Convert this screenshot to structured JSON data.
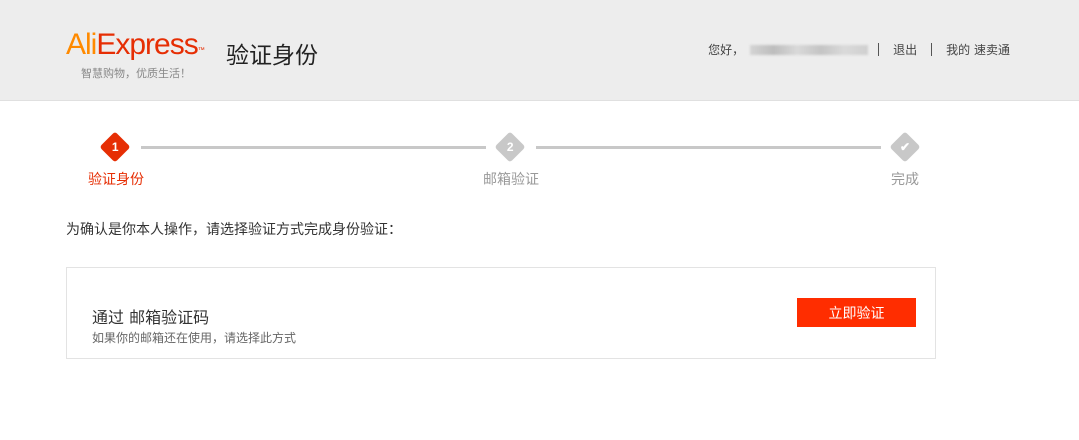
{
  "header": {
    "logo": {
      "part1": "Ali",
      "part2": "Express",
      "tm": "™"
    },
    "slogan": "智慧购物，优质生活！",
    "title": "验证身份",
    "greeting": "您好，",
    "logout": "退出",
    "my_account": "我的 速卖通"
  },
  "steps": [
    {
      "number": "1",
      "label": "验证身份",
      "state": "active",
      "color": "#e62e04"
    },
    {
      "number": "2",
      "label": "邮箱验证",
      "state": "pending",
      "color": "#c8c8c8"
    },
    {
      "number": "✔",
      "label": "完成",
      "state": "pending",
      "color": "#c8c8c8"
    }
  ],
  "intro": "为确认是你本人操作，请选择验证方式完成身份验证：",
  "method": {
    "title": "通过 邮箱验证码",
    "description": "如果你的邮箱还在使用，请选择此方式",
    "button_label": "立即验证"
  },
  "colors": {
    "accent": "#ff2d00",
    "brand_orange": "#ff8a00",
    "brand_red": "#e62e04",
    "inactive": "#c8c8c8"
  }
}
